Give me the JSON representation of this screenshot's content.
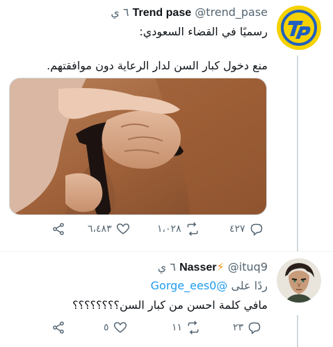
{
  "tweets": [
    {
      "author": {
        "name": "Trend pase",
        "handle": "@trend_pase",
        "time": "٦ ي"
      },
      "lines": [
        "رسميًا في القضاء السعودي:",
        "منع دخول كبار السن لدار الرعاية دون موافقتهم."
      ],
      "actions": {
        "replies": "٤٢٧",
        "retweets": "١،٠٢٨",
        "likes": "٦،٤٨٣"
      }
    },
    {
      "author": {
        "name": "Nasser",
        "handle": "@ituq9",
        "time": "٦ ي"
      },
      "reply_prefix": "ردًا على",
      "reply_to": "@Gorge_ees0",
      "lines": [
        "مافي كلمة احسن من كبار السن؟؟؟؟؟؟؟؟"
      ],
      "actions": {
        "replies": "٢٣",
        "retweets": "١١",
        "likes": "٥"
      }
    }
  ],
  "colors": {
    "muted": "#536471",
    "link": "#1d9bf0",
    "text": "#0f1419",
    "lightning": "#f4900c",
    "logo_bg": "#f5d200",
    "logo_ring": "#1f5fbf"
  },
  "icons": [
    "share-icon",
    "like-icon",
    "retweet-icon",
    "reply-icon",
    "lightning-icon"
  ]
}
